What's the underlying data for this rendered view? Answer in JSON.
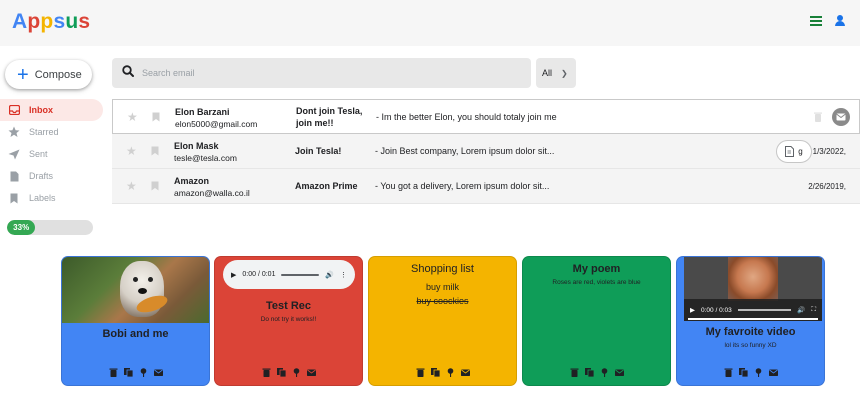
{
  "app": {
    "logo_letters": [
      {
        "ch": "A",
        "color": "#4285f4"
      },
      {
        "ch": "p",
        "color": "#db4437"
      },
      {
        "ch": "p",
        "color": "#f4b400"
      },
      {
        "ch": "s",
        "color": "#4285f4"
      },
      {
        "ch": "u",
        "color": "#0f9d58"
      },
      {
        "ch": "s",
        "color": "#db4437"
      }
    ],
    "header_icons": [
      "menu-icon",
      "user-icon"
    ]
  },
  "sidebar": {
    "compose_label": "Compose",
    "items": [
      {
        "label": "Inbox",
        "icon": "inbox-icon",
        "active": true
      },
      {
        "label": "Starred",
        "icon": "star-icon",
        "active": false
      },
      {
        "label": "Sent",
        "icon": "send-icon",
        "active": false
      },
      {
        "label": "Drafts",
        "icon": "draft-icon",
        "active": false
      },
      {
        "label": "Labels",
        "icon": "label-icon",
        "active": false
      }
    ],
    "progress_label": "33%",
    "progress_value": 0.33
  },
  "search": {
    "placeholder": "Search email",
    "filter_value": "All"
  },
  "mails": [
    {
      "from_name": "Elon Barzani",
      "from_email": "elon5000@gmail.com",
      "subject": "Dont join Tesla, join me!!",
      "body": "- Im the better Elon, you should totaly join me",
      "date": ""
    },
    {
      "from_name": "Elon Mask",
      "from_email": "tesle@tesla.com",
      "subject": "Join Tesla!",
      "body": "- Join Best company, Lorem ipsum dolor sit...",
      "attachment_label": "g",
      "date": "1/3/2022,"
    },
    {
      "from_name": "Amazon",
      "from_email": "amazon@walla.co.il",
      "subject": "Amazon Prime",
      "body": "- You got a delivery, Lorem ipsum dolor sit...",
      "date": "2/26/2019,"
    }
  ],
  "notes": [
    {
      "title": "Bobi and me",
      "text": "",
      "color": "#4285f4"
    },
    {
      "title": "Test Rec",
      "text": "Do not try it works!!",
      "audio_time": "0:00 / 0:01",
      "color": "#db4437"
    },
    {
      "title": "Shopping list",
      "items": [
        "buy milk",
        "buy coockies"
      ],
      "color": "#f4b400"
    },
    {
      "title": "My poem",
      "text": "Roses are red, violets are blue",
      "color": "#0f9d58"
    },
    {
      "title": "My favroite video",
      "text": "lol its so funny XD",
      "video_time": "0:00 / 0:03",
      "color": "#4285f4"
    }
  ]
}
